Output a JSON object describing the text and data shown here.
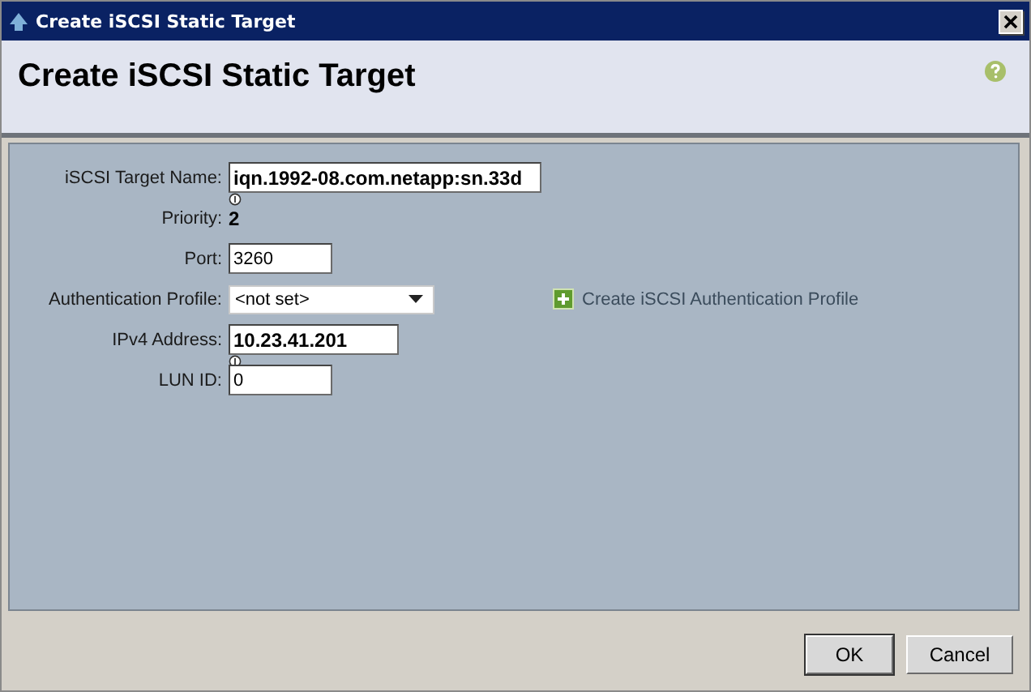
{
  "window": {
    "title": "Create iSCSI Static Target"
  },
  "header": {
    "title": "Create iSCSI Static Target"
  },
  "form": {
    "rows": [
      {
        "kind": "address",
        "label": "iSCSI Target Name:",
        "value": "iqn.1992-08.com.netapp:sn.33d"
      },
      {
        "kind": "static",
        "label": "Priority:",
        "value": "2"
      },
      {
        "kind": "text",
        "label": "Port:",
        "value": "3260"
      },
      {
        "kind": "select",
        "label": "Authentication Profile:",
        "value": "<not set>",
        "link": "Create iSCSI Authentication Profile"
      },
      {
        "kind": "address",
        "label": "IPv4 Address:",
        "value": "10.23.41.201"
      },
      {
        "kind": "text",
        "label": "LUN ID:",
        "value": "0"
      }
    ]
  },
  "buttons": [
    "OK",
    "Cancel"
  ]
}
